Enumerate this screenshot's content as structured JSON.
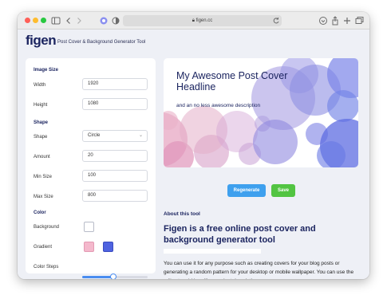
{
  "browser": {
    "url": "figen.cc"
  },
  "app": {
    "logo": "figen",
    "tagline": "Post Cover & Background Generator Tool"
  },
  "sidebar": {
    "image_size_title": "Image Size",
    "width_label": "Width",
    "width_value": "1920",
    "height_label": "Height",
    "height_value": "1080",
    "shape_title": "Shape",
    "shape_label": "Shape",
    "shape_value": "Circle",
    "amount_label": "Amount",
    "amount_value": "20",
    "min_size_label": "Min Size",
    "min_size_value": "100",
    "max_size_label": "Max Size",
    "max_size_value": "800",
    "color_title": "Color",
    "background_label": "Background",
    "background_color": "#ffffff",
    "gradient_label": "Gradient",
    "gradient_color_1": "#f4b8cc",
    "gradient_color_2": "#4f63e0",
    "color_steps_label": "Color Steps",
    "color_steps_fraction": 0.48
  },
  "preview": {
    "headline": "My Awesome Post Cover Headline",
    "description": "and an no less awesome description"
  },
  "actions": {
    "regenerate_label": "Regenerate",
    "save_label": "Save"
  },
  "about": {
    "label": "About this tool",
    "title": "Figen is a free online post cover and background generator tool",
    "text": "You can use it for any purpose such as creating covers for your blog posts or generating a random pattern for your desktop or mobile wallpaper. You can use the editor to add headlines or just descriptions."
  },
  "colors": {
    "brand_navy": "#1c2560",
    "regenerate_blue": "#3ea0ee",
    "save_green": "#52c442"
  }
}
